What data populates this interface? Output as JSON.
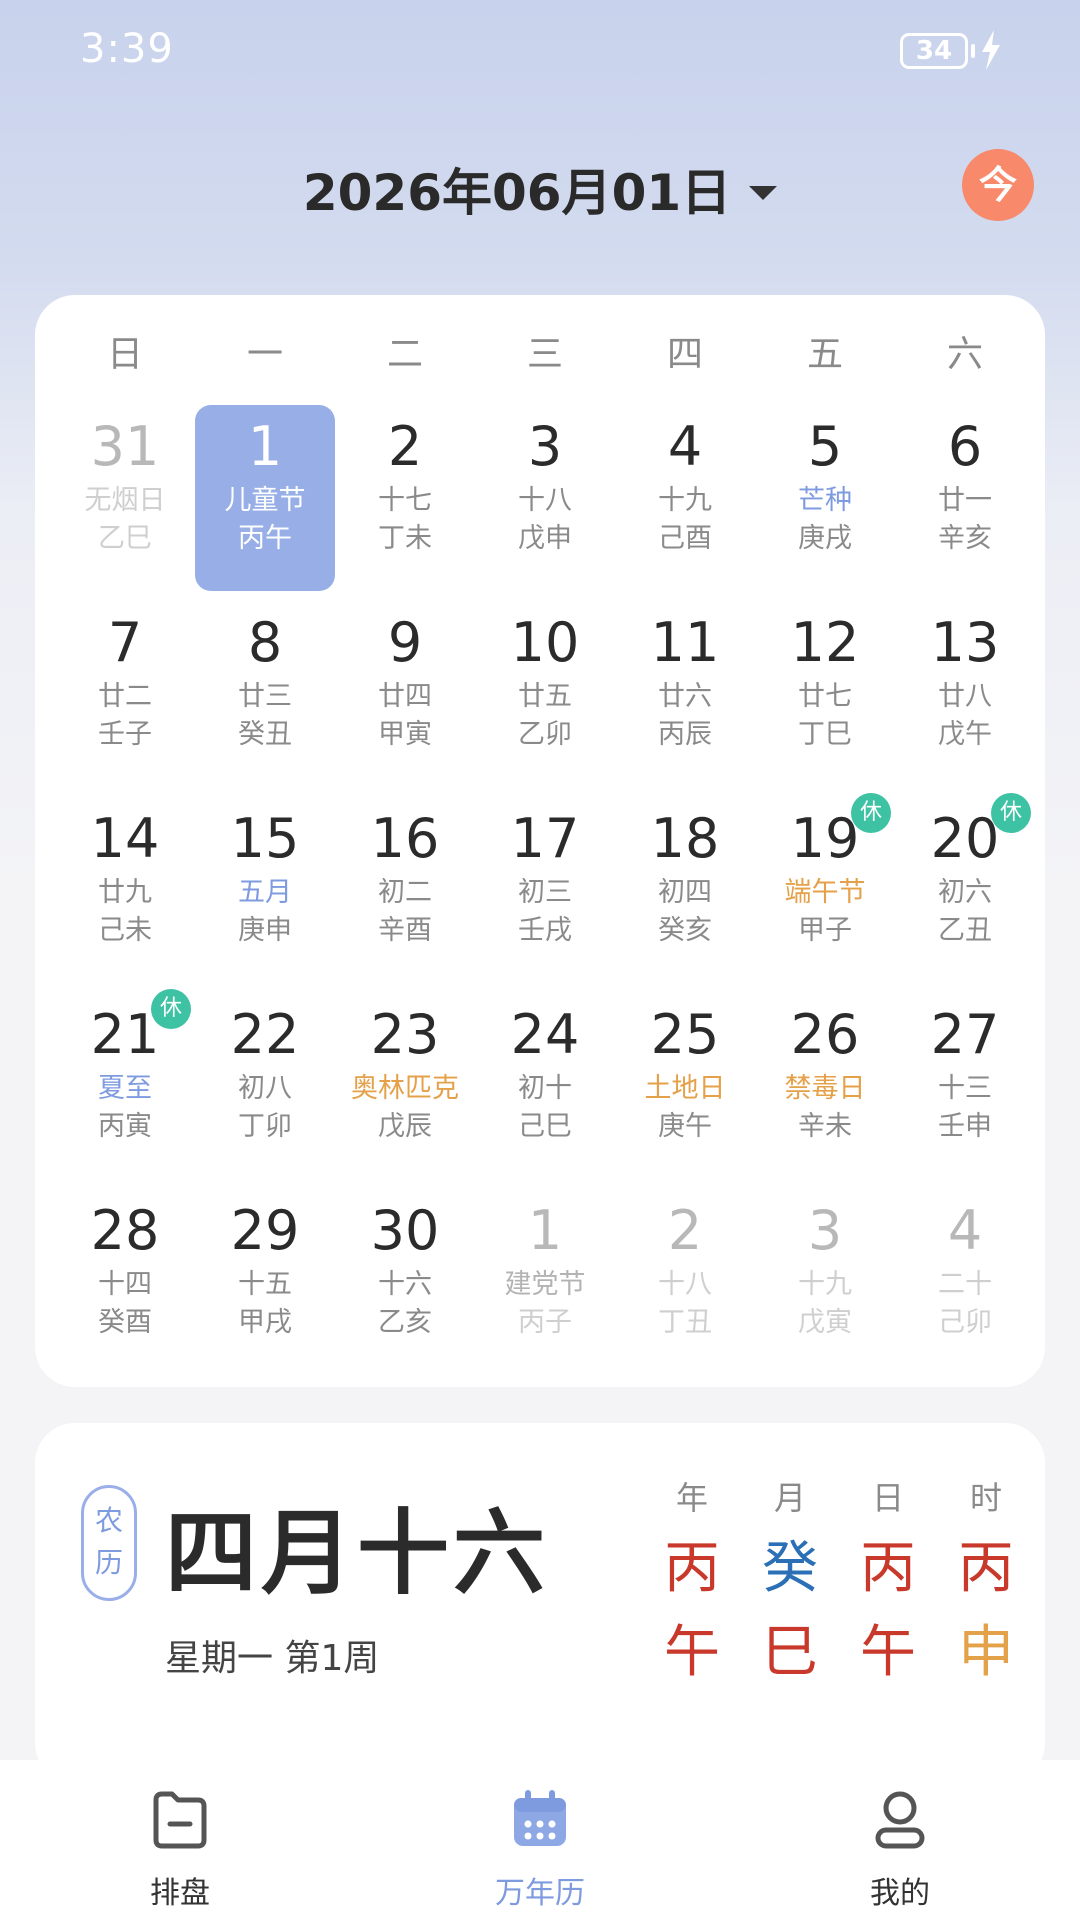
{
  "status": {
    "time": "3:39",
    "battery": "34"
  },
  "header": {
    "date": "2026年06月01日",
    "today_label": "今"
  },
  "weekdays": [
    "日",
    "一",
    "二",
    "三",
    "四",
    "五",
    "六"
  ],
  "weeks": [
    [
      {
        "day": "31",
        "lunar": "无烟日",
        "gz": "乙巳"
      },
      {
        "day": "1",
        "lunar": "儿童节",
        "gz": "丙午"
      },
      {
        "day": "2",
        "lunar": "十七",
        "gz": "丁未"
      },
      {
        "day": "3",
        "lunar": "十八",
        "gz": "戊申"
      },
      {
        "day": "4",
        "lunar": "十九",
        "gz": "己酉"
      },
      {
        "day": "5",
        "lunar": "芒种",
        "gz": "庚戌"
      },
      {
        "day": "6",
        "lunar": "廿一",
        "gz": "辛亥"
      }
    ],
    [
      {
        "day": "7",
        "lunar": "廿二",
        "gz": "壬子"
      },
      {
        "day": "8",
        "lunar": "廿三",
        "gz": "癸丑"
      },
      {
        "day": "9",
        "lunar": "廿四",
        "gz": "甲寅"
      },
      {
        "day": "10",
        "lunar": "廿五",
        "gz": "乙卯"
      },
      {
        "day": "11",
        "lunar": "廿六",
        "gz": "丙辰"
      },
      {
        "day": "12",
        "lunar": "廿七",
        "gz": "丁巳"
      },
      {
        "day": "13",
        "lunar": "廿八",
        "gz": "戊午"
      }
    ],
    [
      {
        "day": "14",
        "lunar": "廿九",
        "gz": "己未"
      },
      {
        "day": "15",
        "lunar": "五月",
        "gz": "庚申"
      },
      {
        "day": "16",
        "lunar": "初二",
        "gz": "辛酉"
      },
      {
        "day": "17",
        "lunar": "初三",
        "gz": "壬戌"
      },
      {
        "day": "18",
        "lunar": "初四",
        "gz": "癸亥"
      },
      {
        "day": "19",
        "lunar": "端午节",
        "gz": "甲子",
        "badge": "休"
      },
      {
        "day": "20",
        "lunar": "初六",
        "gz": "乙丑",
        "badge": "休"
      }
    ],
    [
      {
        "day": "21",
        "lunar": "夏至",
        "gz": "丙寅",
        "badge": "休"
      },
      {
        "day": "22",
        "lunar": "初八",
        "gz": "丁卯"
      },
      {
        "day": "23",
        "lunar": "奥林匹克",
        "gz": "戊辰"
      },
      {
        "day": "24",
        "lunar": "初十",
        "gz": "己巳"
      },
      {
        "day": "25",
        "lunar": "土地日",
        "gz": "庚午"
      },
      {
        "day": "26",
        "lunar": "禁毒日",
        "gz": "辛未"
      },
      {
        "day": "27",
        "lunar": "十三",
        "gz": "壬申"
      }
    ],
    [
      {
        "day": "28",
        "lunar": "十四",
        "gz": "癸酉"
      },
      {
        "day": "29",
        "lunar": "十五",
        "gz": "甲戌"
      },
      {
        "day": "30",
        "lunar": "十六",
        "gz": "乙亥"
      },
      {
        "day": "1",
        "lunar": "建党节",
        "gz": "丙子"
      },
      {
        "day": "2",
        "lunar": "十八",
        "gz": "丁丑"
      },
      {
        "day": "3",
        "lunar": "十九",
        "gz": "戊寅"
      },
      {
        "day": "4",
        "lunar": "二十",
        "gz": "己卯"
      }
    ]
  ],
  "lunar_info": {
    "seal_top": "农",
    "seal_bottom": "历",
    "date": "四月十六",
    "week_info": "星期一 第1周",
    "pillars": [
      {
        "label": "年",
        "stem": "丙",
        "branch": "午"
      },
      {
        "label": "月",
        "stem": "癸",
        "branch": "巳"
      },
      {
        "label": "日",
        "stem": "丙",
        "branch": "午"
      },
      {
        "label": "时",
        "stem": "丙",
        "branch": "申"
      }
    ]
  },
  "nav": [
    {
      "label": "排盘",
      "icon": "folder-icon"
    },
    {
      "label": "万年历",
      "icon": "calendar-icon"
    },
    {
      "label": "我的",
      "icon": "person-icon"
    }
  ],
  "colors": {
    "selected": "#97aee6",
    "holiday_badge": "#3dc2a4",
    "today_button": "#f8896a",
    "solar_term": "#7f9be0",
    "festival": "#e5a14a"
  }
}
